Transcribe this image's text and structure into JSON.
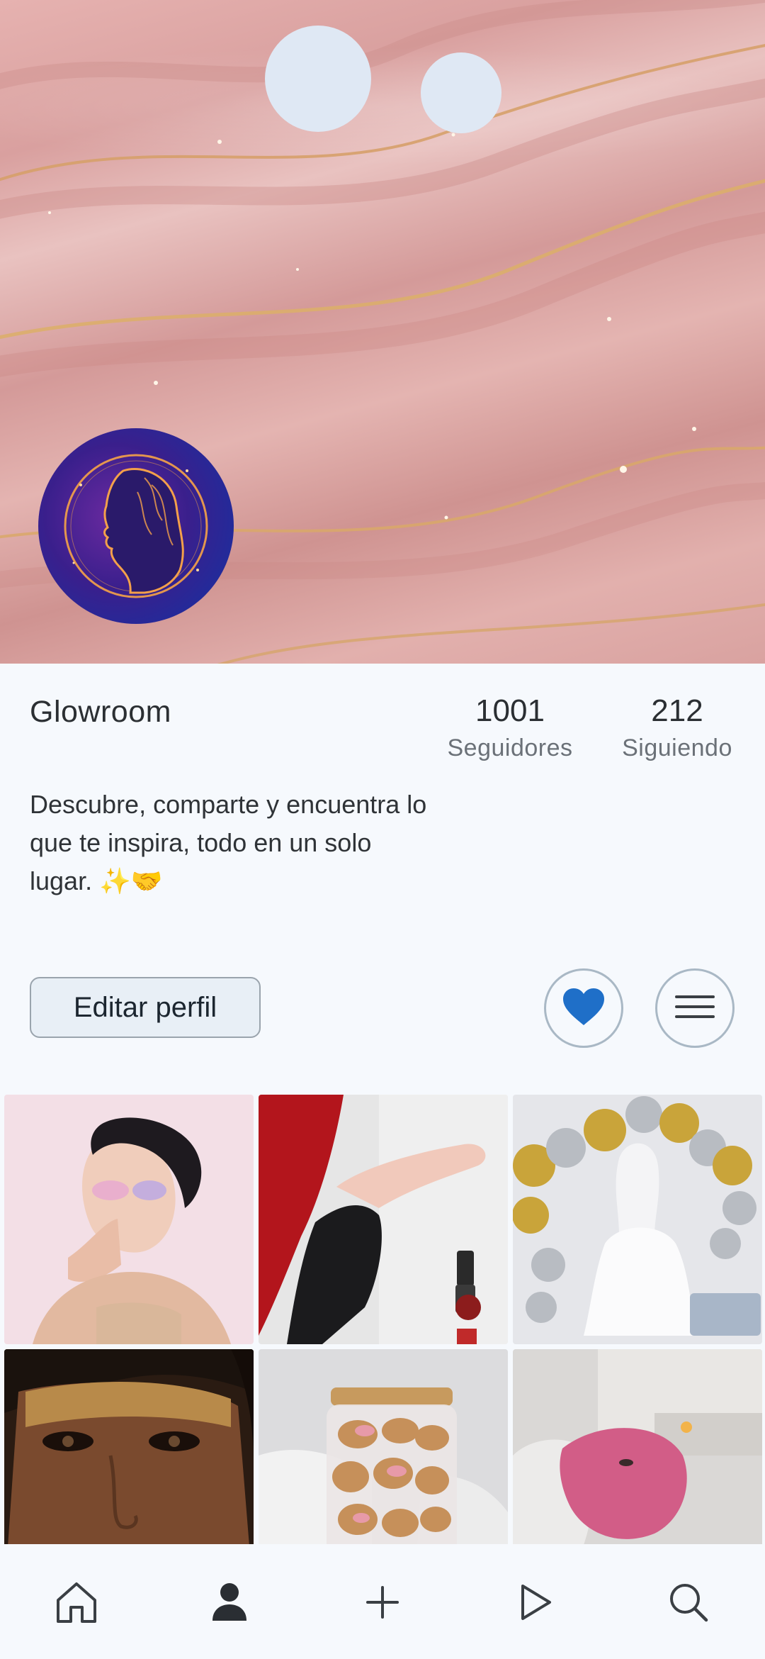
{
  "profile": {
    "name": "Glowroom",
    "followers_count": "1001",
    "followers_label": "Seguidores",
    "following_count": "212",
    "following_label": "Siguiendo",
    "bio_line1": "Descubre, comparte y encuentra lo",
    "bio_line2": "que te inspira, todo en un solo",
    "bio_line3": "lugar. ✨🤝"
  },
  "actions": {
    "edit_label": "Editar perfil"
  },
  "icons": {
    "favorites": "heart-icon",
    "menu": "hamburger-menu-icon"
  },
  "posts": [
    {
      "name": "post-makeup-portrait"
    },
    {
      "name": "post-manicure"
    },
    {
      "name": "post-balloons-doll"
    },
    {
      "name": "post-glitter-face"
    },
    {
      "name": "post-cookie-jar"
    },
    {
      "name": "post-pink-facial-mask"
    }
  ],
  "bottom_nav": [
    "home-icon",
    "profile-icon",
    "add-icon",
    "play-icon",
    "search-icon"
  ],
  "colors": {
    "accent": "#1f6fc8",
    "background": "#f6f9fd"
  }
}
